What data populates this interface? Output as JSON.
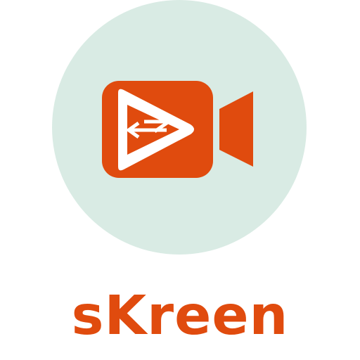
{
  "app": {
    "name": "sKreen"
  },
  "logo": {
    "icon": "video-camera-share-icon",
    "badge_color": "#d9ebe4",
    "accent_color": "#e04b0e",
    "knockout_color": "#ffffff"
  }
}
